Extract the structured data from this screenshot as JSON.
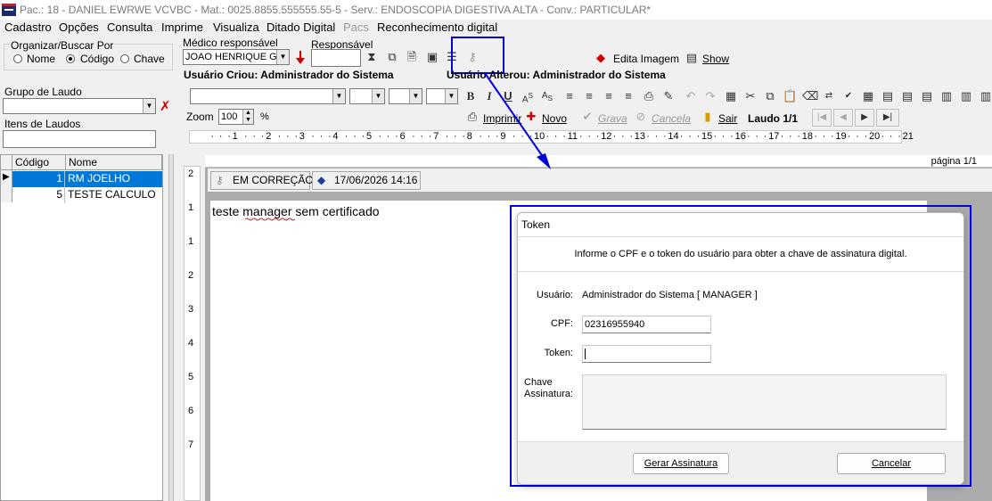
{
  "window": {
    "title": "Pac.: 18 - DANIEL EWRWE VCVBC - Mat.: 0025.8855.555555.55-5 - Serv.: ENDOSCOPIA DIGESTIVA ALTA - Conv.: PARTICULAR*"
  },
  "menu": {
    "items": [
      "Cadastro",
      "Opções",
      "Consulta",
      "Imprime",
      "Visualiza",
      "Ditado Digital",
      "Pacs",
      "Reconhecimento digital"
    ],
    "disabled": [
      "Pacs"
    ]
  },
  "organize": {
    "group_label": "Organizar/Buscar Por",
    "options": [
      "Nome",
      "Código",
      "Chave"
    ],
    "selected": "Código"
  },
  "medico": {
    "label": "Médico responsável",
    "value": "JOAO HENRIQUE G."
  },
  "responsavel": {
    "label": "Responsável",
    "value": ""
  },
  "tools": {
    "edita_imagem": "Edita Imagem",
    "show": "Show"
  },
  "audit": {
    "criou": "Usuário Criou: Administrador do Sistema",
    "alterou": "Usuário Alterou: Administrador do Sistema"
  },
  "left": {
    "grupo_label": "Grupo de Laudo",
    "itens_label": "Itens de Laudos",
    "grid_headers": [
      "Código",
      "Nome"
    ],
    "rows": [
      {
        "codigo": "1",
        "nome": "RM JOELHO",
        "selected": true
      },
      {
        "codigo": "5",
        "nome": "TESTE CALCULO",
        "selected": false
      }
    ]
  },
  "editor_toolbar": {
    "zoom_label": "Zoom",
    "zoom_value": "100",
    "zoom_unit": "%",
    "imprimir": "Imprimir",
    "novo": "Novo",
    "grava": "Grava",
    "cancela": "Cancela",
    "sair": "Sair",
    "laudo": "Laudo 1/1"
  },
  "ruler": {
    "numbers": [
      "1",
      "2",
      "3",
      "4",
      "5",
      "6",
      "7",
      "8",
      "9",
      "10",
      "11",
      "12",
      "13",
      "14",
      "15",
      "16",
      "17",
      "18",
      "19",
      "20",
      "21"
    ],
    "vnumbers": [
      "2",
      "1",
      "1",
      "2",
      "3",
      "4",
      "5",
      "6",
      "7"
    ]
  },
  "document": {
    "page_label": "página 1/1",
    "status_chip": "EM CORREÇÃO",
    "date_chip": "17/06/2026 14:16",
    "body_text": "teste manager sem certificado"
  },
  "token_dialog": {
    "title": "Token",
    "instruction": "Informe o CPF e o token do usuário para obter a chave de assinatura digital.",
    "usuario_label": "Usuário:",
    "usuario_value": "Administrador do Sistema [ MANAGER ]",
    "cpf_label": "CPF:",
    "cpf_value": "02316955940",
    "token_label": "Token:",
    "token_value": "",
    "chave_label_1": "Chave",
    "chave_label_2": "Assinatura:",
    "gerar_btn": "Gerar Assinatura",
    "cancelar_btn": "Cancelar"
  },
  "colors": {
    "selection": "#0078d7",
    "highlight": "#0000e0",
    "flag_red": "#cc0000"
  }
}
